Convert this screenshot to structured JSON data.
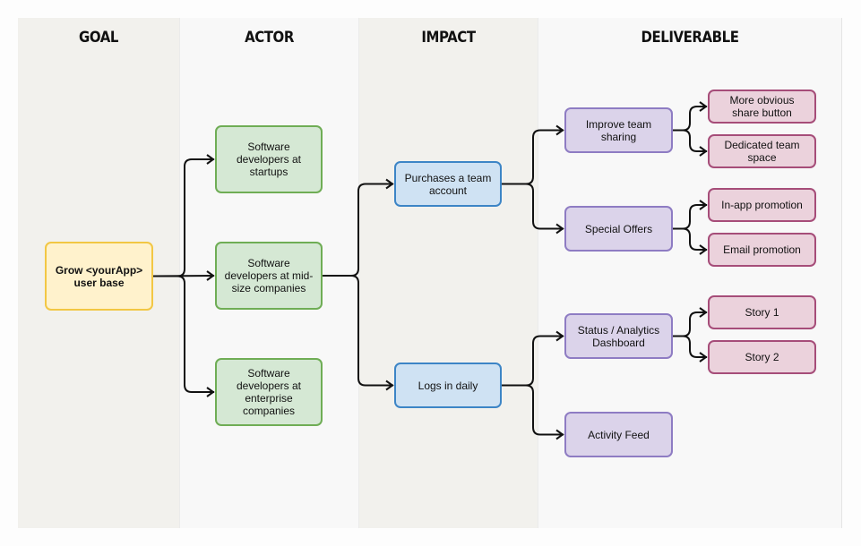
{
  "lanes": [
    {
      "id": "goal",
      "title": "GOAL"
    },
    {
      "id": "actor",
      "title": "ACTOR"
    },
    {
      "id": "impact",
      "title": "IMPACT"
    },
    {
      "id": "deliverable",
      "title": "DELIVERABLE"
    }
  ],
  "nodes": {
    "goal": "Grow <yourApp> user base",
    "actor_startups": "Software developers at startups",
    "actor_midsize": "Software developers at mid-size companies",
    "actor_enterprise": "Software developers at enterprise companies",
    "impact_purchase": "Purchases a team account",
    "impact_logs": "Logs in daily",
    "deliv_sharing": "Improve team sharing",
    "deliv_offers": "Special Offers",
    "deliv_dashboard": "Status / Analytics Dashboard",
    "deliv_feed": "Activity Feed",
    "story_share_button": "More obvious share button",
    "story_team_space": "Dedicated team space",
    "story_inapp": "In-app promotion",
    "story_email": "Email promotion",
    "story_1": "Story 1",
    "story_2": "Story 2"
  },
  "edges": [
    [
      "goal",
      "actor_startups"
    ],
    [
      "goal",
      "actor_midsize"
    ],
    [
      "goal",
      "actor_enterprise"
    ],
    [
      "actor_midsize",
      "impact_purchase"
    ],
    [
      "actor_midsize",
      "impact_logs"
    ],
    [
      "impact_purchase",
      "deliv_sharing"
    ],
    [
      "impact_purchase",
      "deliv_offers"
    ],
    [
      "impact_logs",
      "deliv_dashboard"
    ],
    [
      "impact_logs",
      "deliv_feed"
    ],
    [
      "deliv_sharing",
      "story_share_button"
    ],
    [
      "deliv_sharing",
      "story_team_space"
    ],
    [
      "deliv_offers",
      "story_inapp"
    ],
    [
      "deliv_offers",
      "story_email"
    ],
    [
      "deliv_dashboard",
      "story_1"
    ],
    [
      "deliv_dashboard",
      "story_2"
    ]
  ],
  "colors": {
    "goal_fill": "#fff2cc",
    "goal_border": "#f2c744",
    "actor_fill": "#d5e8d4",
    "actor_border": "#6fad55",
    "impact_fill": "#cfe2f3",
    "impact_border": "#3d85c6",
    "deliverable_fill": "#dbd3ea",
    "deliverable_border": "#8e7cc3",
    "story_fill": "#ebd2dc",
    "story_border": "#a64d79"
  }
}
